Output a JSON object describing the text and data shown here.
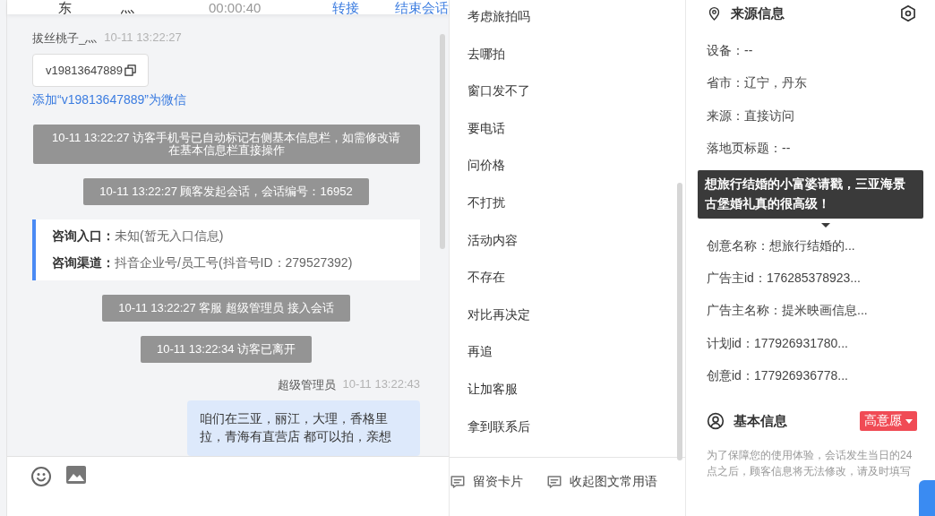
{
  "header": [
    {
      "kind": "text",
      "text": "东"
    },
    {
      "kind": "text",
      "text": "灬"
    },
    {
      "kind": "timer",
      "text": "00:00:40"
    },
    {
      "kind": "link",
      "text": "转接"
    },
    {
      "kind": "link",
      "text": "结束会话"
    }
  ],
  "messages": [
    {
      "kind": "visitor_header",
      "name": "拔丝桃子_灬",
      "time": "10-11 13:22:27"
    },
    {
      "kind": "copy_card",
      "text": "v19813647889"
    },
    {
      "kind": "link",
      "text": "添加“v19813647889”为微信"
    },
    {
      "kind": "system",
      "text": "10-11 13:22:27 访客手机号已自动标记右侧基本信息栏，如需修改请在基本信息栏直接操作"
    },
    {
      "kind": "system",
      "text": "10-11 13:22:27 顾客发起会话，会话编号：16952"
    },
    {
      "kind": "info_card",
      "rows": [
        {
          "label": "咨询入口：",
          "value": "未知(暂无入口信息)"
        },
        {
          "label": "咨询渠道：",
          "value": "抖音企业号/员工号(抖音号ID：279527392)"
        }
      ]
    },
    {
      "kind": "system",
      "text": "10-11 13:22:27 客服 超级管理员 接入会话"
    },
    {
      "kind": "system",
      "text": "10-11 13:22:34 访客已离开"
    },
    {
      "kind": "agent_header",
      "name": "超级管理员",
      "time": "10-11 13:22:43"
    },
    {
      "kind": "agent_bubble",
      "text": "咱们在三亚，丽江，大理，香格里拉，青海有直营店 都可以拍，亲想"
    }
  ],
  "quick_replies": [
    "考虑旅拍吗",
    "去哪拍",
    "窗口发不了",
    "要电话",
    "问价格",
    "不打扰",
    "活动内容",
    "不存在",
    "对比再决定",
    "再追",
    "让加客服",
    "拿到联系后"
  ],
  "reply_toolbar": [
    {
      "label": "留资卡片"
    },
    {
      "label": "收起图文常用语"
    }
  ],
  "source_info": {
    "title": "来源信息",
    "fields_above": [
      "设备：--",
      "省市：辽宁，丹东",
      "来源：直接访问",
      "落地页标题：--"
    ],
    "fields_below": [
      "创意名称：想旅行结婚的...",
      "广告主id：176285378923...",
      "广告主名称：提米映画信息...",
      "计划id：177926931780...",
      "创意id：177926936778..."
    ],
    "tooltip": "想旅行结婚的小富婆请戳，三亚海景古堡婚礼真的很高级！"
  },
  "basic_info": {
    "title": "基本信息",
    "tag": "高意愿",
    "note": "为了保障您的使用体验，会话发生当日的24点之后，顾客信息将无法修改，请及时填写"
  }
}
